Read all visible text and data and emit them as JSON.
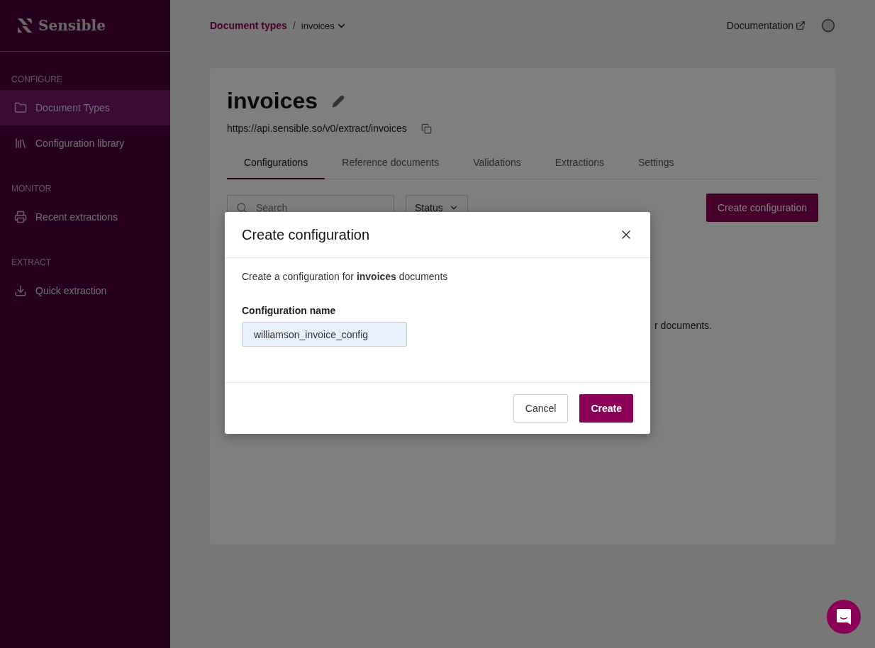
{
  "sidebar": {
    "logo": "Sensible",
    "sections": [
      {
        "title": "CONFIGURE",
        "items": [
          {
            "label": "Document Types",
            "selected": true
          },
          {
            "label": "Configuration library",
            "selected": false
          }
        ]
      },
      {
        "title": "MONITOR",
        "items": [
          {
            "label": "Recent extractions",
            "selected": false
          }
        ]
      },
      {
        "title": "EXTRACT",
        "items": [
          {
            "label": "Quick extraction",
            "selected": false
          }
        ]
      }
    ]
  },
  "breadcrumb": {
    "parent": "Document types",
    "separator": "/",
    "current": "invoices"
  },
  "topbar": {
    "documentation": "Documentation"
  },
  "document": {
    "title": "invoices",
    "url": "https://api.sensible.so/v0/extract/invoices",
    "tabs": [
      {
        "label": "Configurations",
        "selected": true
      },
      {
        "label": "Reference documents",
        "selected": false
      },
      {
        "label": "Validations",
        "selected": false
      },
      {
        "label": "Extractions",
        "selected": false
      },
      {
        "label": "Settings",
        "selected": false
      }
    ],
    "search": {
      "placeholder": "Search"
    },
    "status_filter": "Status",
    "create_button": "Create configuration",
    "empty_text": "r documents."
  },
  "dialog": {
    "title": "Create configuration",
    "description": "Create a configuration for **invoices** documents",
    "field_label": "Configuration name",
    "field_value": "williamson_invoice_config",
    "cancel": "Cancel",
    "confirm": "Create"
  }
}
